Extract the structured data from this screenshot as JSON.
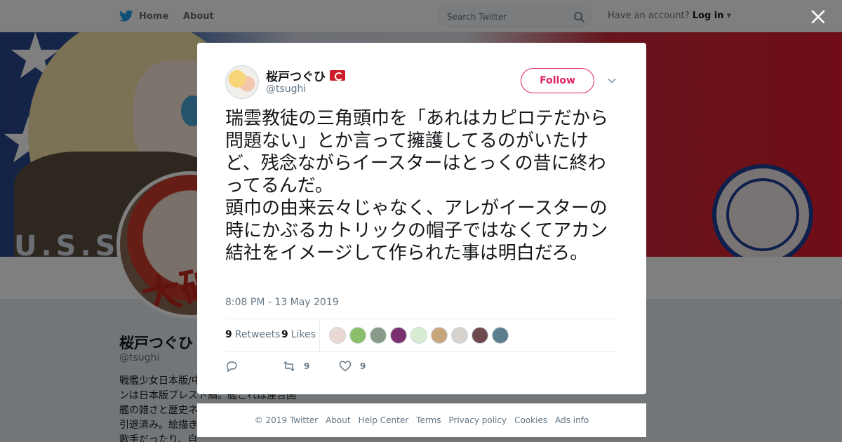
{
  "nav": {
    "home_label": "Home",
    "about_label": "About",
    "search_placeholder": "Search Twitter",
    "account_prompt": "Have an account?",
    "login_label": "Log in"
  },
  "banner": {
    "ship_text": "U.S.S"
  },
  "profile": {
    "name": "桜戸つぐひ",
    "handle": "@tsughi",
    "bio": "戦艦少女日本版/中\nンは日本版ブレスト鯖。艦これは連合国\n艦の雑さと歴史ネ\n引退済み。絵描き\n歌手だったり、自"
  },
  "tweet": {
    "author_name": "桜戸つぐひ",
    "author_handle": "@tsughi",
    "follow_label": "Follow",
    "text": "瑞雲教徒の三角頭巾を「あれはカピロテだから問題ない」とか言って擁護してるのがいたけど、残念ながらイースターはとっくの昔に終わってるんだ。\n頭巾の由来云々じゃなく、アレがイースターの時にかぶるカトリックの帽子ではなくてアカン結社をイメージして作られた事は明白だろ。",
    "timestamp": "8:08 PM - 13 May 2019",
    "retweets_count": "9",
    "retweets_label": "Retweets",
    "likes_count": "9",
    "likes_label": "Likes",
    "action_retweet_count": "9",
    "action_like_count": "9",
    "liker_colors": [
      "#e9d9d2",
      "#8cbf6b",
      "#8a9a88",
      "#7a2f6e",
      "#d7ecd1",
      "#c7a57b",
      "#d8d2cc",
      "#6e4a4f",
      "#5a7e8e"
    ]
  },
  "footer": {
    "links": [
      "© 2019 Twitter",
      "About",
      "Help Center",
      "Terms",
      "Privacy policy",
      "Cookies",
      "Ads info"
    ]
  },
  "colors": {
    "accent": "#1da1f2",
    "follow": "#e0245e",
    "text": "#14171a",
    "muted": "#657786"
  }
}
